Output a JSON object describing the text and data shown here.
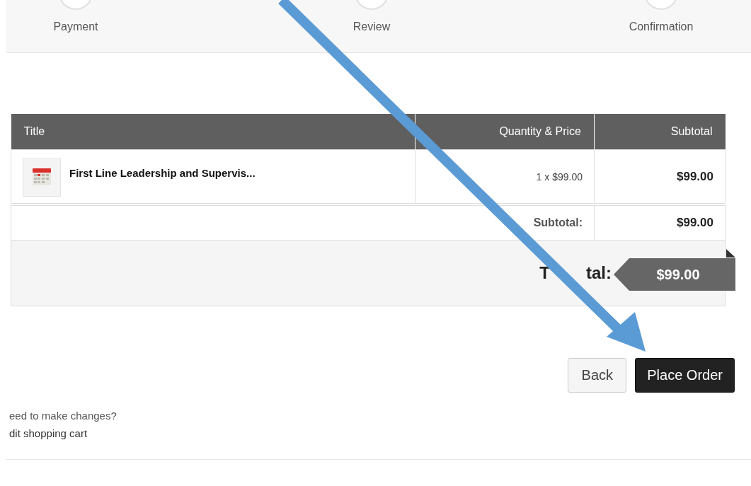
{
  "steps": [
    {
      "label": "Payment"
    },
    {
      "label": "Review"
    },
    {
      "label": "Confirmation"
    }
  ],
  "cart": {
    "columns": [
      "Title",
      "Quantity & Price",
      "Subtotal"
    ],
    "items": [
      {
        "title": "First Line Leadership and Supervis...",
        "quantity_price": "1 x $99.00",
        "subtotal": "$99.00"
      }
    ],
    "subtotal_label": "Subtotal:",
    "subtotal_value": "$99.00",
    "total_label_parts": [
      "T",
      "tal:"
    ],
    "total_value": "$99.00"
  },
  "buttons": [
    {
      "label": "Back",
      "kind": "secondary"
    },
    {
      "label": "Place Order",
      "kind": "primary"
    }
  ],
  "changes": {
    "prompt": "eed to make changes?",
    "link": "dit shopping cart"
  }
}
